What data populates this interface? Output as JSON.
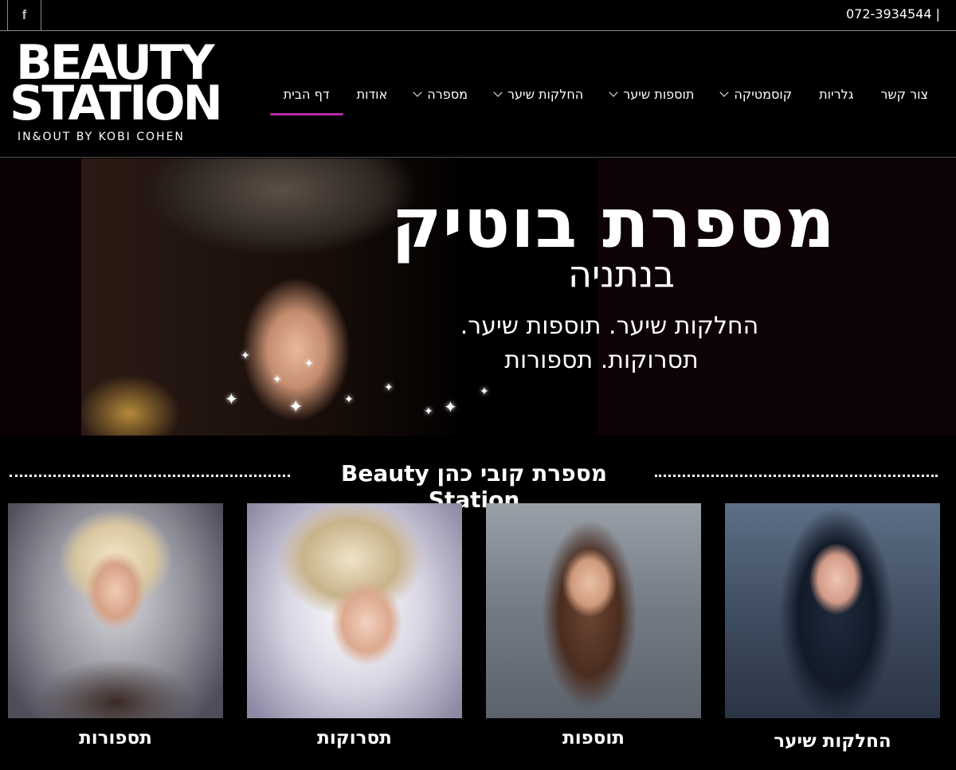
{
  "topbar": {
    "facebook_icon": "f",
    "phone": "072-3934544  |"
  },
  "logo": {
    "line1": "BEAUTY",
    "line2": "STATION",
    "line3": "IN&OUT BY KOBI COHEN"
  },
  "nav": {
    "items": [
      {
        "label": "דף הבית",
        "active": true,
        "dropdown": false
      },
      {
        "label": "אודות",
        "active": false,
        "dropdown": false
      },
      {
        "label": "מספרה",
        "active": false,
        "dropdown": true
      },
      {
        "label": "החלקות שיער",
        "active": false,
        "dropdown": true
      },
      {
        "label": "תוספות שיער",
        "active": false,
        "dropdown": true
      },
      {
        "label": "קוסמטיקה",
        "active": false,
        "dropdown": true
      },
      {
        "label": "גלריות",
        "active": false,
        "dropdown": false
      },
      {
        "label": "צור קשר",
        "active": false,
        "dropdown": false
      }
    ],
    "accent_color": "#b42aa2"
  },
  "hero": {
    "title": "מספרת בוטיק",
    "subtitle": "בנתניה",
    "line1": "החלקות שיער.  תוספות שיער.",
    "line2": "תסרוקות.  תספורות"
  },
  "section": {
    "title": "מספרת קובי כהן Beauty Station"
  },
  "cards": [
    {
      "label": "תספורות"
    },
    {
      "label": "תסרוקות"
    },
    {
      "label": "תוספות"
    },
    {
      "label": "החלקות שיער"
    }
  ]
}
